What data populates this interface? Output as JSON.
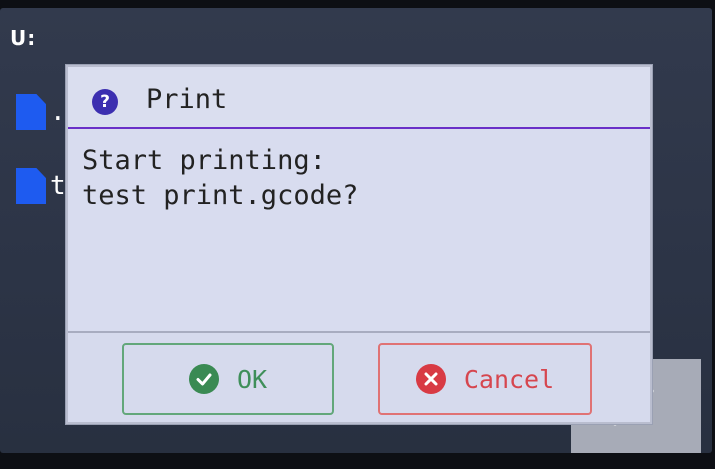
{
  "screen": {
    "path": "U:",
    "files": [
      {
        "name": "."
      },
      {
        "name": "t"
      }
    ]
  },
  "dialog": {
    "title": "Print",
    "title_icon": "question-circle-icon",
    "message_lines": [
      "Start printing:",
      "test print.gcode?"
    ],
    "buttons": {
      "ok": {
        "label": "OK",
        "icon": "check-circle-icon"
      },
      "cancel": {
        "label": "Cancel",
        "icon": "x-circle-icon"
      }
    }
  },
  "colors": {
    "dialog_bg": "#d8dcef",
    "title_divider": "#6a30c8",
    "ok": "#3f8f5a",
    "cancel": "#d6464f",
    "file_icon": "#1e5bf0"
  }
}
